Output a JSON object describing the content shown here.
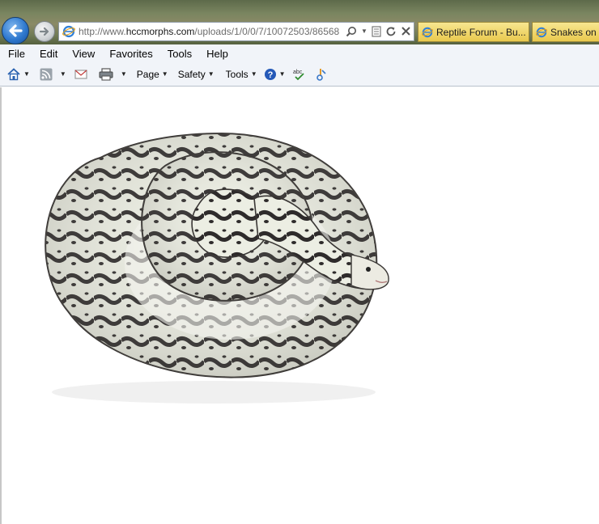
{
  "browser": {
    "address": {
      "url_prefix": "http://www.",
      "url_domain": "hccmorphs.com",
      "url_rest": "/uploads/1/0/0/7/10072503/86568"
    },
    "tabs": [
      {
        "label": "Reptile Forum - Bu..."
      },
      {
        "label": "Snakes on a"
      }
    ]
  },
  "menu": {
    "items": [
      {
        "label": "File"
      },
      {
        "label": "Edit"
      },
      {
        "label": "View"
      },
      {
        "label": "Favorites"
      },
      {
        "label": "Tools"
      },
      {
        "label": "Help"
      }
    ]
  },
  "commandbar": {
    "page_label": "Page",
    "safety_label": "Safety",
    "tools_label": "Tools"
  },
  "colors": {
    "titlebar": "#6f7a55",
    "tab_active": "#e9c94e",
    "back_button": "#2f79cf",
    "snake_dark": "#2e2b2b",
    "snake_light": "#eceee3"
  }
}
